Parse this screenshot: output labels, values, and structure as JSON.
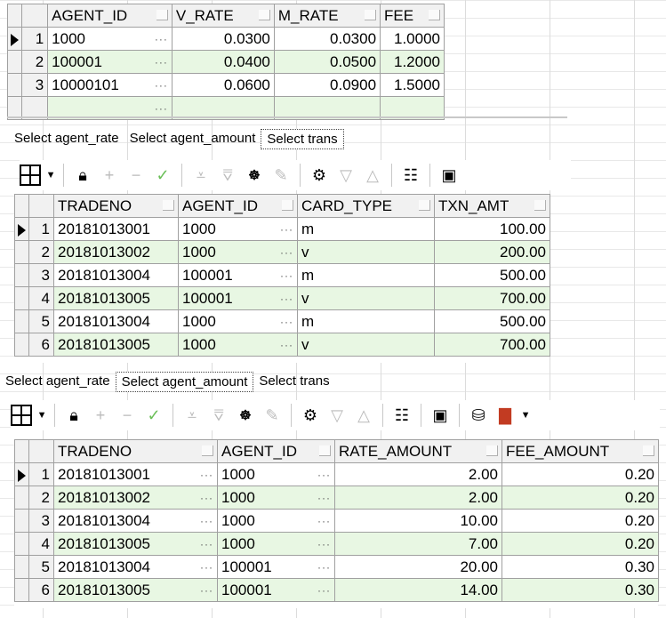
{
  "grid1": {
    "columns": [
      "AGENT_ID",
      "V_RATE",
      "M_RATE",
      "FEE"
    ],
    "rows": [
      {
        "n": "1",
        "agent_id": "1000",
        "v_rate": "0.0300",
        "m_rate": "0.0300",
        "fee": "1.0000"
      },
      {
        "n": "2",
        "agent_id": "100001",
        "v_rate": "0.0400",
        "m_rate": "0.0500",
        "fee": "1.2000"
      },
      {
        "n": "3",
        "agent_id": "10000101",
        "v_rate": "0.0600",
        "m_rate": "0.0900",
        "fee": "1.5000"
      }
    ]
  },
  "tabs1": [
    "Select agent_rate",
    "Select agent_amount",
    "Select trans"
  ],
  "grid2": {
    "columns": [
      "TRADENO",
      "AGENT_ID",
      "CARD_TYPE",
      "TXN_AMT"
    ],
    "rows": [
      {
        "n": "1",
        "tradeno": "20181013001",
        "agent_id": "1000",
        "card_type": "m",
        "txn_amt": "100.00"
      },
      {
        "n": "2",
        "tradeno": "20181013002",
        "agent_id": "1000",
        "card_type": "v",
        "txn_amt": "200.00"
      },
      {
        "n": "3",
        "tradeno": "20181013004",
        "agent_id": "100001",
        "card_type": "m",
        "txn_amt": "500.00"
      },
      {
        "n": "4",
        "tradeno": "20181013005",
        "agent_id": "100001",
        "card_type": "v",
        "txn_amt": "700.00"
      },
      {
        "n": "5",
        "tradeno": "20181013004",
        "agent_id": "1000",
        "card_type": "m",
        "txn_amt": "500.00"
      },
      {
        "n": "6",
        "tradeno": "20181013005",
        "agent_id": "1000",
        "card_type": "v",
        "txn_amt": "700.00"
      }
    ]
  },
  "tabs2": [
    "Select agent_rate",
    "Select agent_amount",
    "Select trans"
  ],
  "grid3": {
    "columns": [
      "TRADENO",
      "AGENT_ID",
      "RATE_AMOUNT",
      "FEE_AMOUNT"
    ],
    "rows": [
      {
        "n": "1",
        "tradeno": "20181013001",
        "agent_id": "1000",
        "rate_amount": "2.00",
        "fee_amount": "0.20"
      },
      {
        "n": "2",
        "tradeno": "20181013002",
        "agent_id": "1000",
        "rate_amount": "2.00",
        "fee_amount": "0.20"
      },
      {
        "n": "3",
        "tradeno": "20181013004",
        "agent_id": "1000",
        "rate_amount": "10.00",
        "fee_amount": "0.20"
      },
      {
        "n": "4",
        "tradeno": "20181013005",
        "agent_id": "1000",
        "rate_amount": "7.00",
        "fee_amount": "0.20"
      },
      {
        "n": "5",
        "tradeno": "20181013004",
        "agent_id": "100001",
        "rate_amount": "20.00",
        "fee_amount": "0.30"
      },
      {
        "n": "6",
        "tradeno": "20181013005",
        "agent_id": "100001",
        "rate_amount": "14.00",
        "fee_amount": "0.30"
      }
    ]
  },
  "icons": {
    "grid": "grid-select-icon",
    "lock": "lock-icon",
    "add": "plus-icon",
    "remove": "minus-icon",
    "post": "check-icon",
    "filter": "filter-icon",
    "find": "binoculars-icon",
    "clear": "eraser-icon",
    "query": "query-icon",
    "down": "triangle-down-icon",
    "up": "triangle-up-icon",
    "explain": "explain-plan-icon",
    "save": "save-icon"
  },
  "colors": {
    "even_row": "#e8f7e3",
    "header": "#f1f1f1",
    "check": "#6bbf59"
  }
}
